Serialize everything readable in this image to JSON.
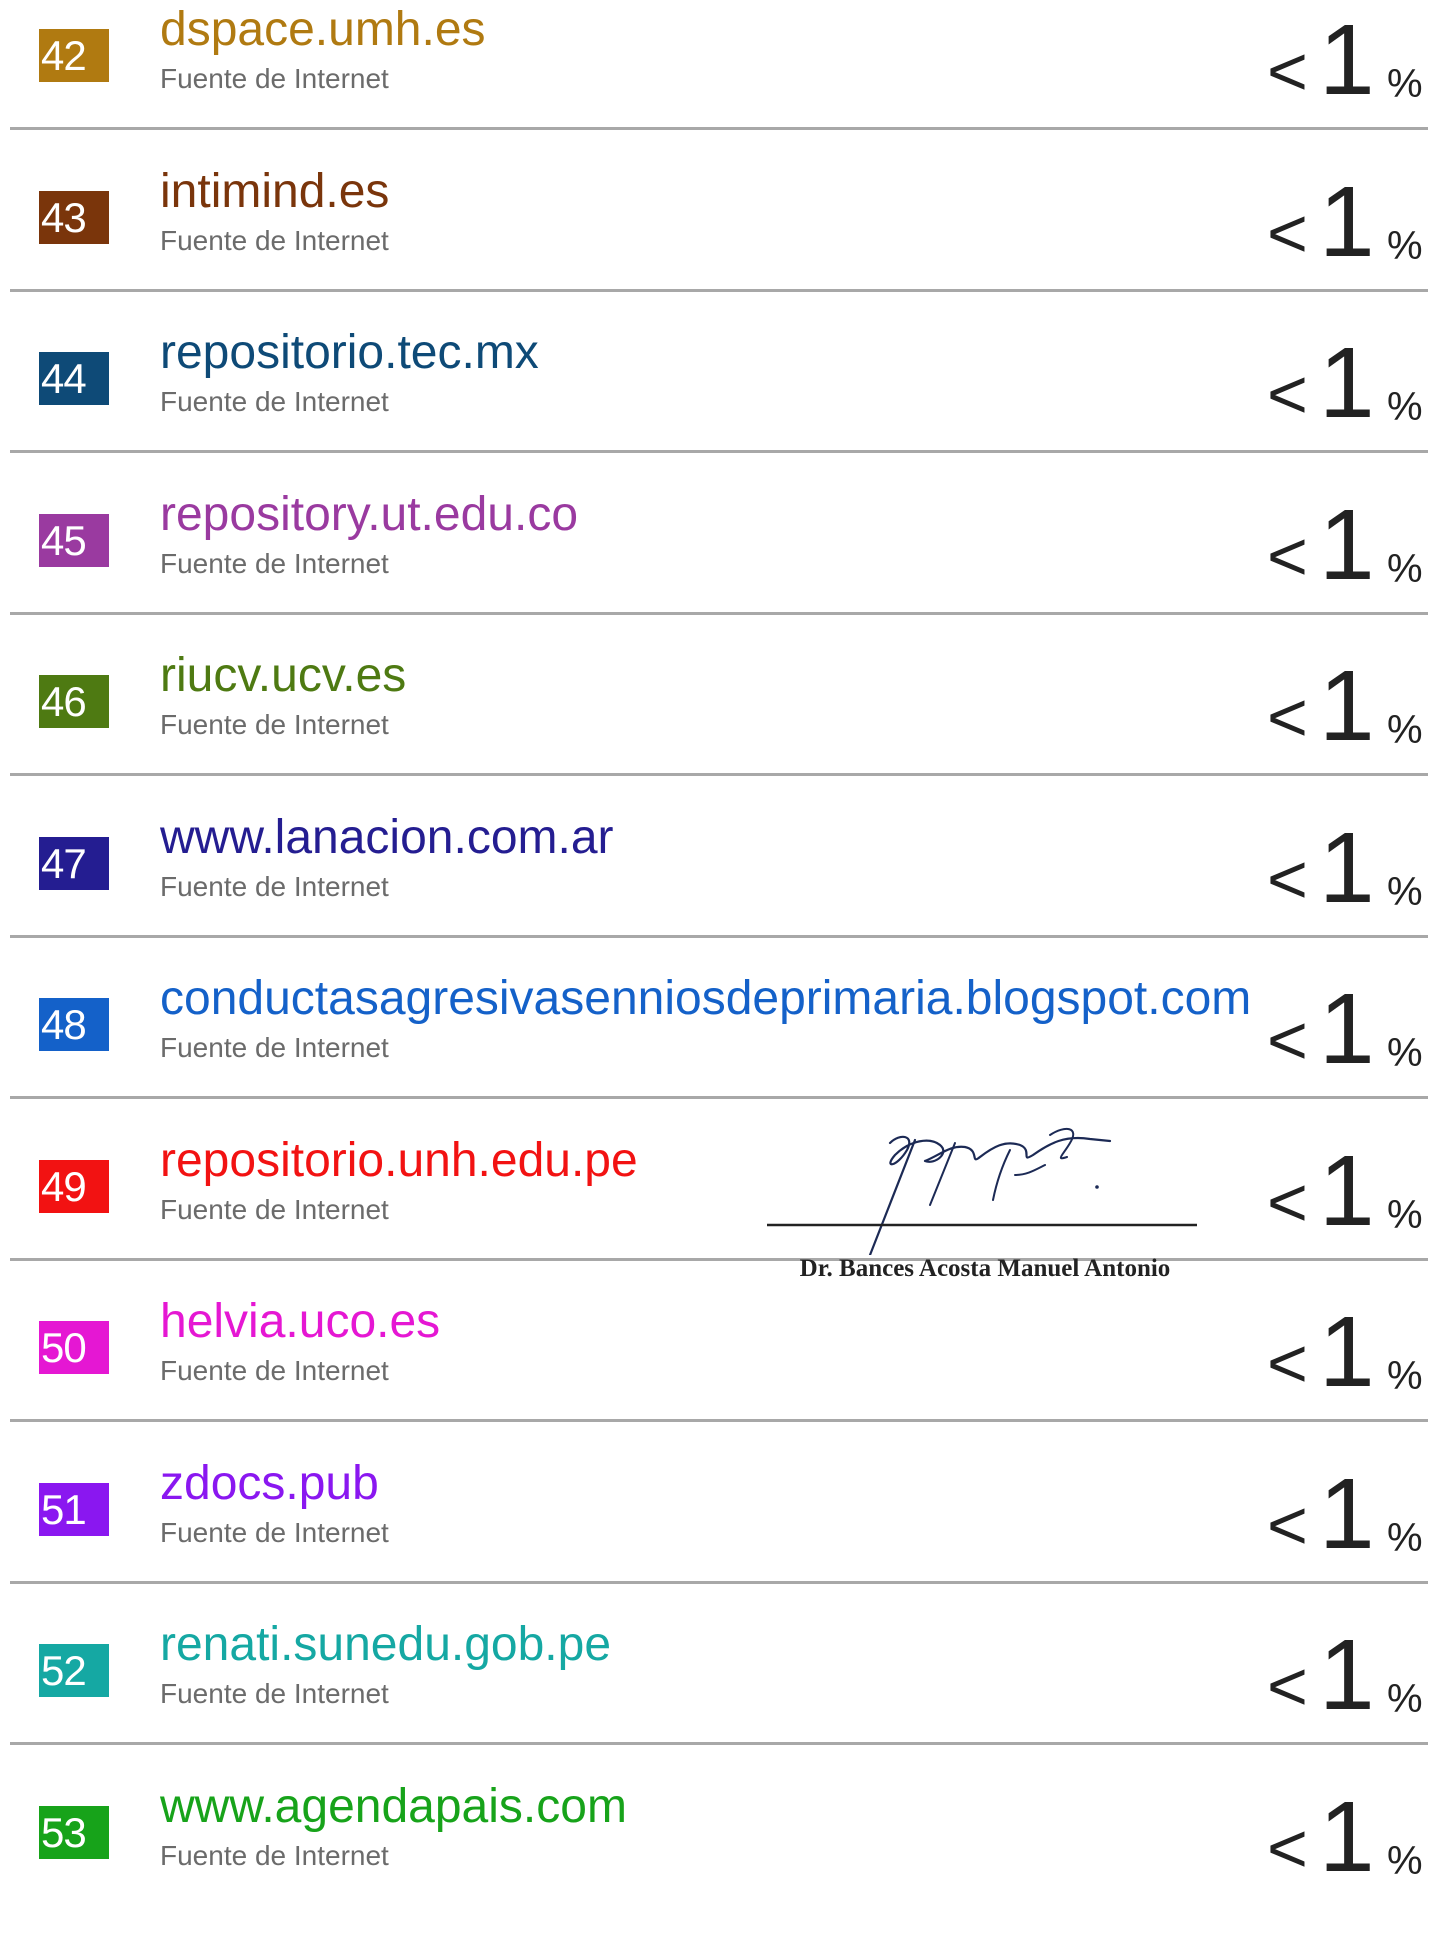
{
  "sources": [
    {
      "num": "42",
      "name": "dspace.umh.es",
      "type": "Fuente de Internet",
      "pct_prefix": "<",
      "pct_value": "1",
      "pct_sign": "%",
      "color": "#b07a11"
    },
    {
      "num": "43",
      "name": "intimind.es",
      "type": "Fuente de Internet",
      "pct_prefix": "<",
      "pct_value": "1",
      "pct_sign": "%",
      "color": "#7a350b"
    },
    {
      "num": "44",
      "name": "repositorio.tec.mx",
      "type": "Fuente de Internet",
      "pct_prefix": "<",
      "pct_value": "1",
      "pct_sign": "%",
      "color": "#0e4a77"
    },
    {
      "num": "45",
      "name": "repository.ut.edu.co",
      "type": "Fuente de Internet",
      "pct_prefix": "<",
      "pct_value": "1",
      "pct_sign": "%",
      "color": "#9a3aa0"
    },
    {
      "num": "46",
      "name": "riucv.ucv.es",
      "type": "Fuente de Internet",
      "pct_prefix": "<",
      "pct_value": "1",
      "pct_sign": "%",
      "color": "#4e7a12"
    },
    {
      "num": "47",
      "name": "www.lanacion.com.ar",
      "type": "Fuente de Internet",
      "pct_prefix": "<",
      "pct_value": "1",
      "pct_sign": "%",
      "color": "#241d91"
    },
    {
      "num": "48",
      "name": "conductasagresivasenniosdeprimaria.blogspot.com",
      "type": "Fuente de Internet",
      "pct_prefix": "<",
      "pct_value": "1",
      "pct_sign": "%",
      "color": "#1461c9"
    },
    {
      "num": "49",
      "name": "repositorio.unh.edu.pe",
      "type": "Fuente de Internet",
      "pct_prefix": "<",
      "pct_value": "1",
      "pct_sign": "%",
      "color": "#f21212"
    },
    {
      "num": "50",
      "name": "helvia.uco.es",
      "type": "Fuente de Internet",
      "pct_prefix": "<",
      "pct_value": "1",
      "pct_sign": "%",
      "color": "#e517d3"
    },
    {
      "num": "51",
      "name": "zdocs.pub",
      "type": "Fuente de Internet",
      "pct_prefix": "<",
      "pct_value": "1",
      "pct_sign": "%",
      "color": "#8a17f0"
    },
    {
      "num": "52",
      "name": "renati.sunedu.gob.pe",
      "type": "Fuente de Internet",
      "pct_prefix": "<",
      "pct_value": "1",
      "pct_sign": "%",
      "color": "#15a8a3"
    },
    {
      "num": "53",
      "name": "www.agendapais.com",
      "type": "Fuente de Internet",
      "pct_prefix": "<",
      "pct_value": "1",
      "pct_sign": "%",
      "color": "#17a31a"
    }
  ],
  "signature": {
    "name": "Dr. Bances Acosta Manuel Antonio"
  }
}
